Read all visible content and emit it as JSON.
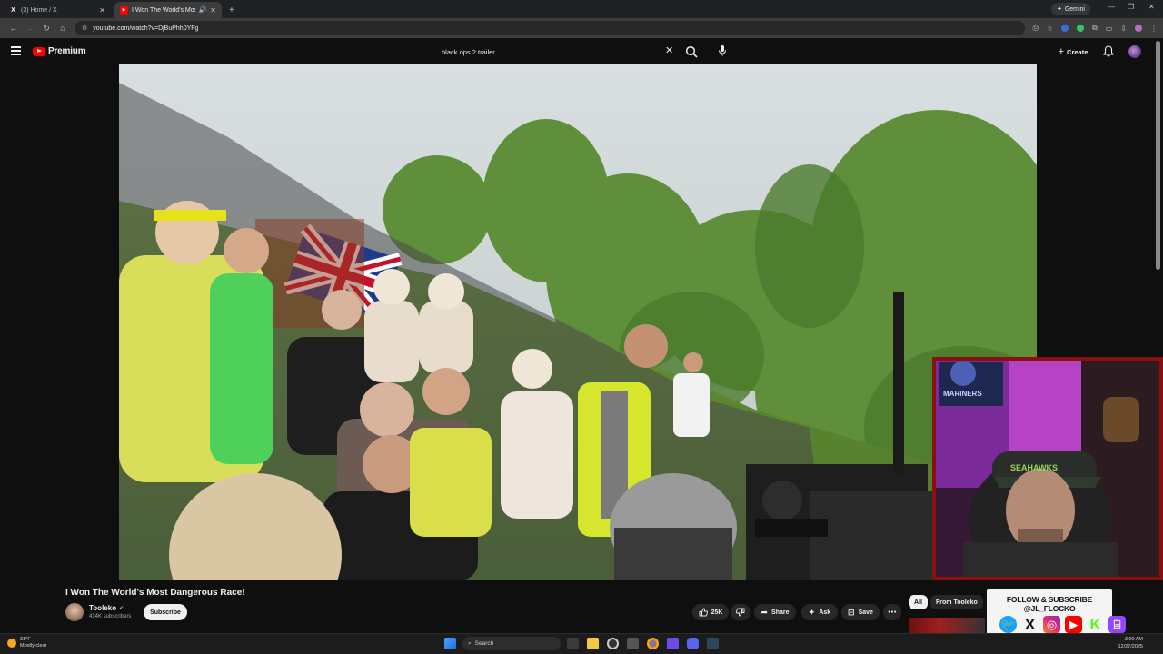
{
  "browser": {
    "tabs": [
      {
        "title": "(3) Home / X",
        "favicon": "x-logo-icon",
        "active": false
      },
      {
        "title": "I Won The World's Most Da",
        "favicon": "youtube-icon",
        "active": true
      }
    ],
    "gemini_label": "Gemini",
    "url": "youtube.com/watch?v=DjBuPhh0YFg"
  },
  "youtube": {
    "logo_text": "Premium",
    "search_query": "black ops 2 trailer",
    "create_label": "Create"
  },
  "video": {
    "title": "I Won The World's Most Dangerous Race!",
    "channel": "Tooleko",
    "subscribers": "434K subscribers",
    "subscribe_label": "Subscribe",
    "likes": "25K",
    "share_label": "Share",
    "ask_label": "Ask",
    "save_label": "Save"
  },
  "recommendations": {
    "chips": [
      "All",
      "From Tooleko"
    ]
  },
  "overlay": {
    "follow_text": "FOLLOW & SUBSCRIBE @JL_FLOCKO",
    "webcam_sign": "MARINERS"
  },
  "taskbar": {
    "temp": "31°F",
    "condition": "Mostly clear",
    "search_placeholder": "Search",
    "time": "3:00 AM",
    "date": "12/27/2025"
  },
  "colors": {
    "accent_red": "#ff0000",
    "background": "#0f0f0f",
    "webcam_border": "#8a0f0f"
  }
}
